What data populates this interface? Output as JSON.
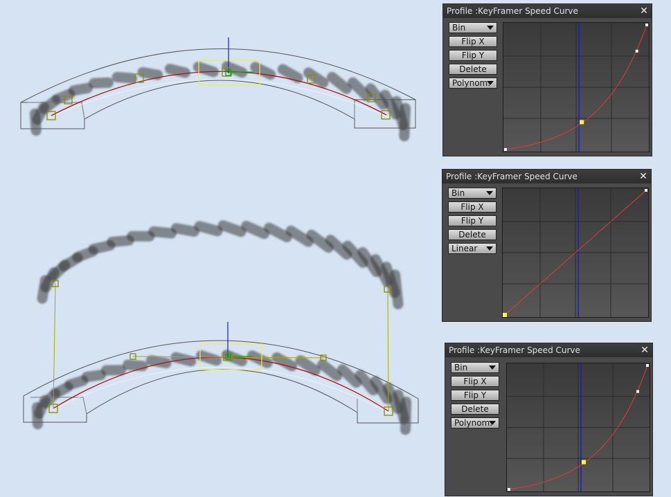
{
  "panels": [
    {
      "title": "Profile :KeyFramer Speed Curve",
      "close_glyph": "✕",
      "bin_label": "Bin",
      "flip_x_label": "Flip X",
      "flip_y_label": "Flip Y",
      "delete_label": "Delete",
      "mode_label": "Polynom.",
      "curve_type": "polynomial",
      "playhead": 0.52,
      "keys": [
        {
          "t": 0.0,
          "v": 0.0
        },
        {
          "t": 0.54,
          "v": 0.22,
          "selected": true
        },
        {
          "t": 0.93,
          "v": 0.79
        },
        {
          "t": 1.0,
          "v": 1.0
        }
      ]
    },
    {
      "title": "Profile :KeyFramer Speed Curve",
      "close_glyph": "✕",
      "bin_label": "Bin",
      "flip_x_label": "Flip X",
      "flip_y_label": "Flip Y",
      "delete_label": "Delete",
      "mode_label": "Linear",
      "curve_type": "linear",
      "playhead": 0.52,
      "keys": [
        {
          "t": 0.0,
          "v": 0.0,
          "selected": true
        },
        {
          "t": 1.0,
          "v": 1.0
        }
      ]
    },
    {
      "title": "Profile :KeyFramer Speed Curve",
      "close_glyph": "✕",
      "bin_label": "Bin",
      "flip_x_label": "Flip X",
      "flip_y_label": "Flip Y",
      "delete_label": "Delete",
      "mode_label": "Polynom.",
      "curve_type": "polynomial",
      "playhead": 0.52,
      "keys": [
        {
          "t": 0.0,
          "v": 0.0
        },
        {
          "t": 0.54,
          "v": 0.22,
          "selected": true
        },
        {
          "t": 0.93,
          "v": 0.79
        },
        {
          "t": 1.0,
          "v": 1.0
        }
      ]
    }
  ],
  "colors": {
    "background": "#d5e3f3",
    "panel": "#4a4a4a",
    "curve": "#e23a3a",
    "playhead": "#1a1ad0",
    "key_selected": "#ffff33",
    "key": "#ffffff",
    "handle": "#8a8a00",
    "motion_path": "#b01010",
    "gizmo_green": "#00b000",
    "cage": "#555555",
    "stroke_shadow": "#3a3a3a"
  }
}
